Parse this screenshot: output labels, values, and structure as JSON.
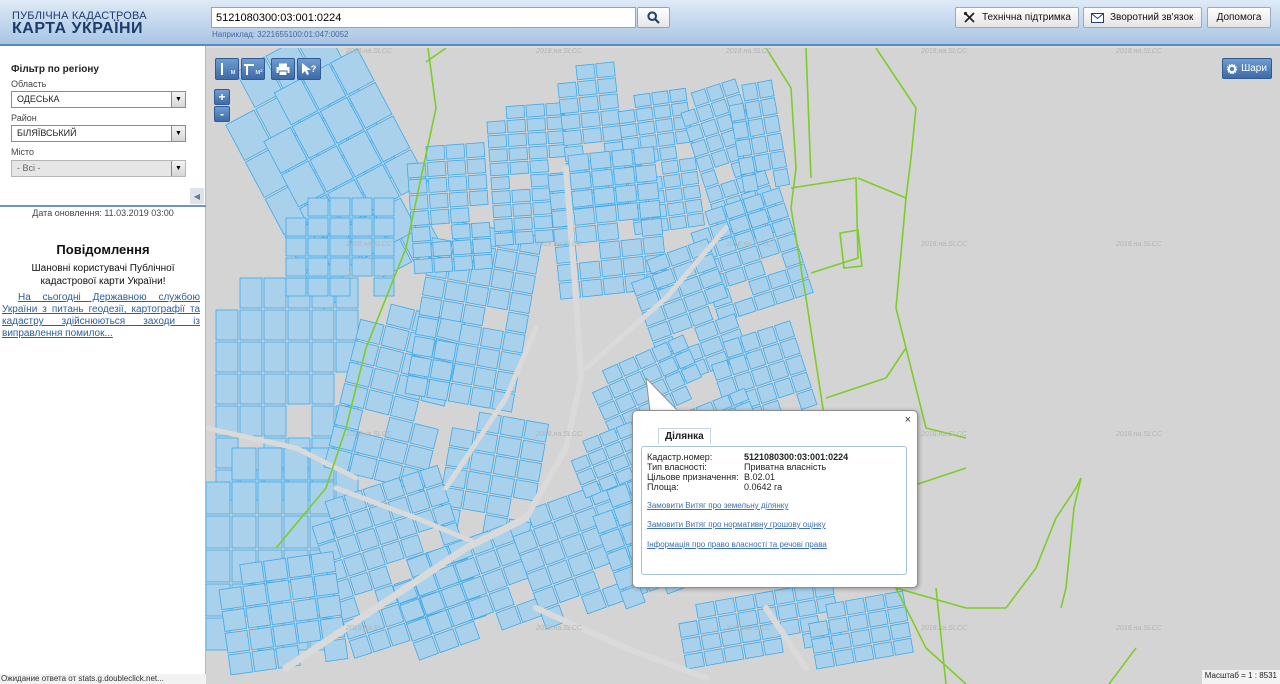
{
  "header": {
    "logo_line1": "ПУБЛІЧНА КАДАСТРОВА",
    "logo_line2": "КАРТА УКРАЇНИ",
    "search_value": "5121080300:03:001:0224",
    "search_hint": "Наприклад: 3221655100:01:047:0052",
    "buttons": {
      "support": "Технічна підтримка",
      "feedback": "Зворотний зв'язок",
      "help": "Допомога"
    }
  },
  "filter": {
    "title": "Фільтр по регіону",
    "region_label": "Область",
    "region_value": "ОДЕСЬКА",
    "district_label": "Район",
    "district_value": "БІЛЯЇВСЬКИЙ",
    "city_label": "Місто",
    "city_value": "- Всі -"
  },
  "update_date": "Дата оновлення: 11.03.2019 03:00",
  "notice": {
    "title": "Повідомлення",
    "body": "Шановні користувачі Публічної кадастрової карти України!",
    "link": "На сьогодні Державною службою України з питань геодезії, картографії та кадастру здійснюються заходи із виправлення помилок..."
  },
  "status_bar": "Ожидание ответа от stats.g.doubleclick.net...",
  "map": {
    "tools": {
      "measure_line": "м",
      "measure_area": "м²",
      "print": "",
      "identify": "?"
    },
    "zoom_in": "+",
    "zoom_out": "-",
    "layers_label": "Шари",
    "scale": "Масштаб = 1 : 8531",
    "watermark": "2018.на.SLCC",
    "colors": {
      "parcel_fill": "#a9d1ec",
      "parcel_stroke": "#3fa9e8",
      "boundary": "#7ccd28",
      "road": "#dadada"
    }
  },
  "popup": {
    "tab": "Ділянка",
    "rows": [
      {
        "label": "Кадастр.номер:",
        "value": "5121080300:03:001:0224"
      },
      {
        "label": "Тип власності:",
        "value": "Приватна власність"
      },
      {
        "label": "Цільове призначення:",
        "value": "В.02.01"
      },
      {
        "label": "Площа:",
        "value": "0.0642 га"
      }
    ],
    "links": [
      "Замовити Витяг про земельну ділянку",
      "Замовити Витяг про нормативну грошову оцінку",
      "Інформація про право власності та речові права"
    ],
    "close": "×"
  }
}
